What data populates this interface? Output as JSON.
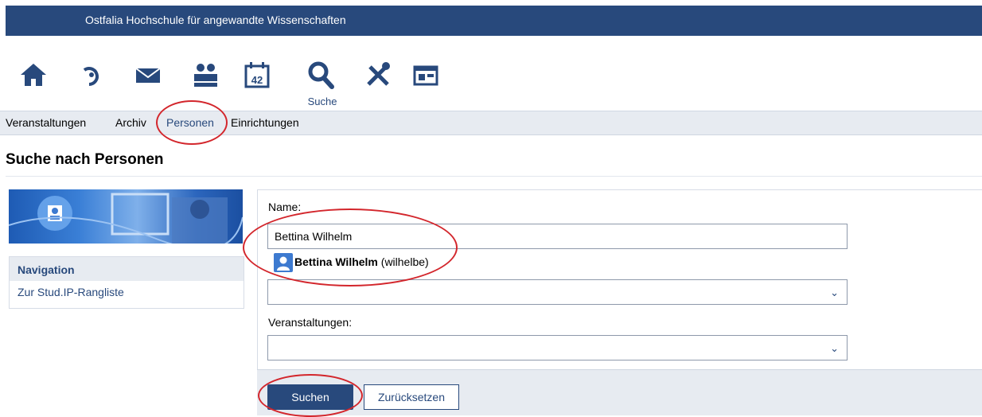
{
  "header": {
    "title": "Ostfalia Hochschule für angewandte Wissenschaften"
  },
  "iconbar": {
    "items": [
      {
        "icon": "home-icon"
      },
      {
        "icon": "activity-icon"
      },
      {
        "icon": "mail-icon"
      },
      {
        "icon": "community-icon"
      },
      {
        "icon": "calendar-icon",
        "badge": "42"
      },
      {
        "icon": "search-icon",
        "label": "Suche",
        "active": true
      },
      {
        "icon": "tools-icon"
      },
      {
        "icon": "browse-icon"
      }
    ],
    "accent": "#28497c"
  },
  "subnav": {
    "items": [
      {
        "label": "Veranstaltungen"
      },
      {
        "label": "Archiv"
      },
      {
        "label": "Personen",
        "active": true
      },
      {
        "label": "Einrichtungen"
      }
    ]
  },
  "page": {
    "title": "Suche nach Personen"
  },
  "sidebar": {
    "nav_heading": "Navigation",
    "nav_link": "Zur Stud.IP-Rangliste"
  },
  "form": {
    "name_label": "Name:",
    "name_value": "Bettina Wilhelm",
    "suggestion_name": "Bettina Wilhelm",
    "suggestion_user": "(wilhelbe)",
    "courses_label": "Veranstaltungen:",
    "search_button": "Suchen",
    "reset_button": "Zurücksetzen"
  },
  "colors": {
    "brand": "#28497c",
    "highlight_marker": "#d3262c"
  }
}
